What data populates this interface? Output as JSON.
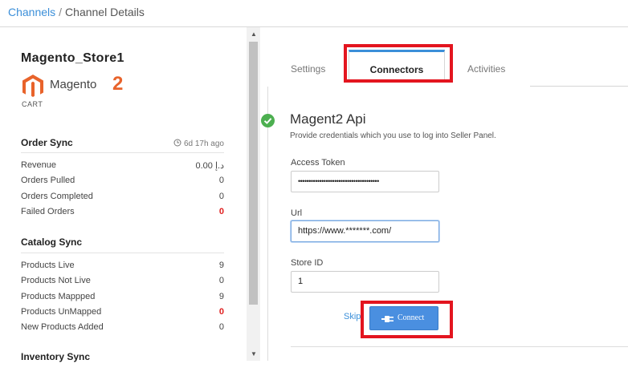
{
  "breadcrumb": {
    "root": "Channels",
    "separator": "/",
    "current": "Channel Details"
  },
  "store": {
    "name": "Magento_Store1",
    "logo_word": "Magento",
    "logo_suffix": "2",
    "type": "CART"
  },
  "order_sync": {
    "title": "Order Sync",
    "last_sync": "6d 17h ago",
    "rows": [
      {
        "label": "Revenue",
        "value": "د.إ 0.00"
      },
      {
        "label": "Orders Pulled",
        "value": "0"
      },
      {
        "label": "Orders Completed",
        "value": "0"
      },
      {
        "label": "Failed Orders",
        "value": "0"
      }
    ]
  },
  "catalog_sync": {
    "title": "Catalog Sync",
    "rows": [
      {
        "label": "Products Live",
        "value": "9"
      },
      {
        "label": "Products Not Live",
        "value": "0"
      },
      {
        "label": "Products Mappped",
        "value": "9"
      },
      {
        "label": "Products UnMapped",
        "value": "0"
      },
      {
        "label": "New Products Added",
        "value": "0"
      }
    ]
  },
  "inventory_sync": {
    "title": "Inventory Sync"
  },
  "tabs": {
    "settings": "Settings",
    "connectors": "Connectors",
    "activities": "Activities",
    "active": "Connectors"
  },
  "connector": {
    "title": "Magent2 Api",
    "description": "Provide credentials which you use to log into Seller Panel.",
    "access_token_label": "Access Token",
    "access_token_value": "••••••••••••••••••••••••••••••••••••••",
    "url_label": "Url",
    "url_value": "https://www.*******.com/",
    "store_id_label": "Store ID",
    "store_id_value": "1",
    "skip_label": "Skip",
    "connect_label": "Connect"
  },
  "colors": {
    "accent": "#3b8fd9",
    "highlight": "#e3151f",
    "success": "#4caf50",
    "failed": "#e02020",
    "magento_orange": "#e8632b"
  }
}
